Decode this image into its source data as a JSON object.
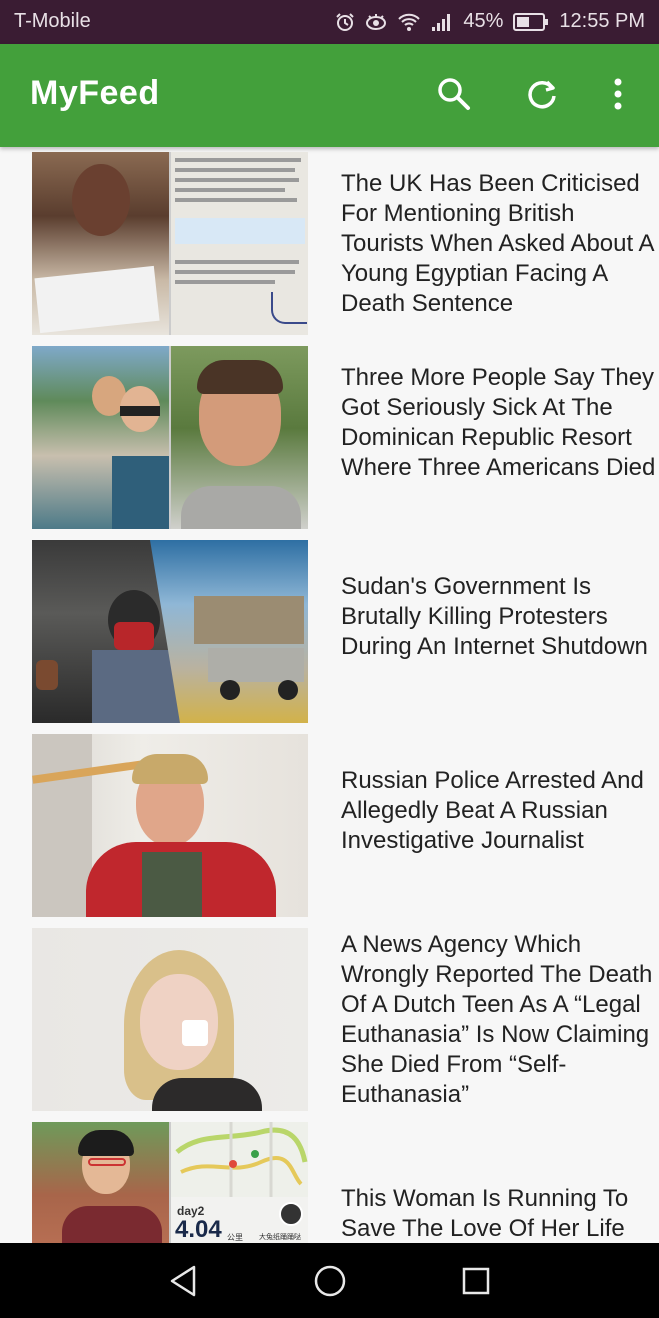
{
  "status_bar": {
    "carrier": "T-Mobile",
    "battery": "45%",
    "time": "12:55 PM"
  },
  "app_bar": {
    "title": "MyFeed",
    "actions": [
      "search-icon",
      "refresh-icon",
      "overflow-menu-icon"
    ]
  },
  "feed": {
    "items": [
      {
        "headline": "The UK Has Been Criticised For Mentioning British Tourists When Asked About A Young Egyptian Facing A Death Sentence"
      },
      {
        "headline": "Three More People Say They Got Seriously Sick At The Dominican Republic Resort Where Three Americans Died"
      },
      {
        "headline": "Sudan's Government Is Brutally Killing Protesters During An Internet Shutdown"
      },
      {
        "headline": "Russian Police Arrested And Allegedly Beat A Russian Investigative Journalist"
      },
      {
        "headline": "A News Agency Which Wrongly Reported The Death Of A Dutch Teen As A “Legal Euthanasia” Is Now Claiming She Died From “Self-Euthanasia”"
      },
      {
        "headline": "This Woman Is Running To Save The Love Of Her Life",
        "thumb_text": {
          "day": "day2",
          "distance": "4.04",
          "unit": "公里",
          "user": "大兔纸踊踊哒"
        }
      }
    ]
  },
  "nav_bar": {
    "buttons": [
      "back-icon",
      "home-icon",
      "recents-icon"
    ]
  }
}
